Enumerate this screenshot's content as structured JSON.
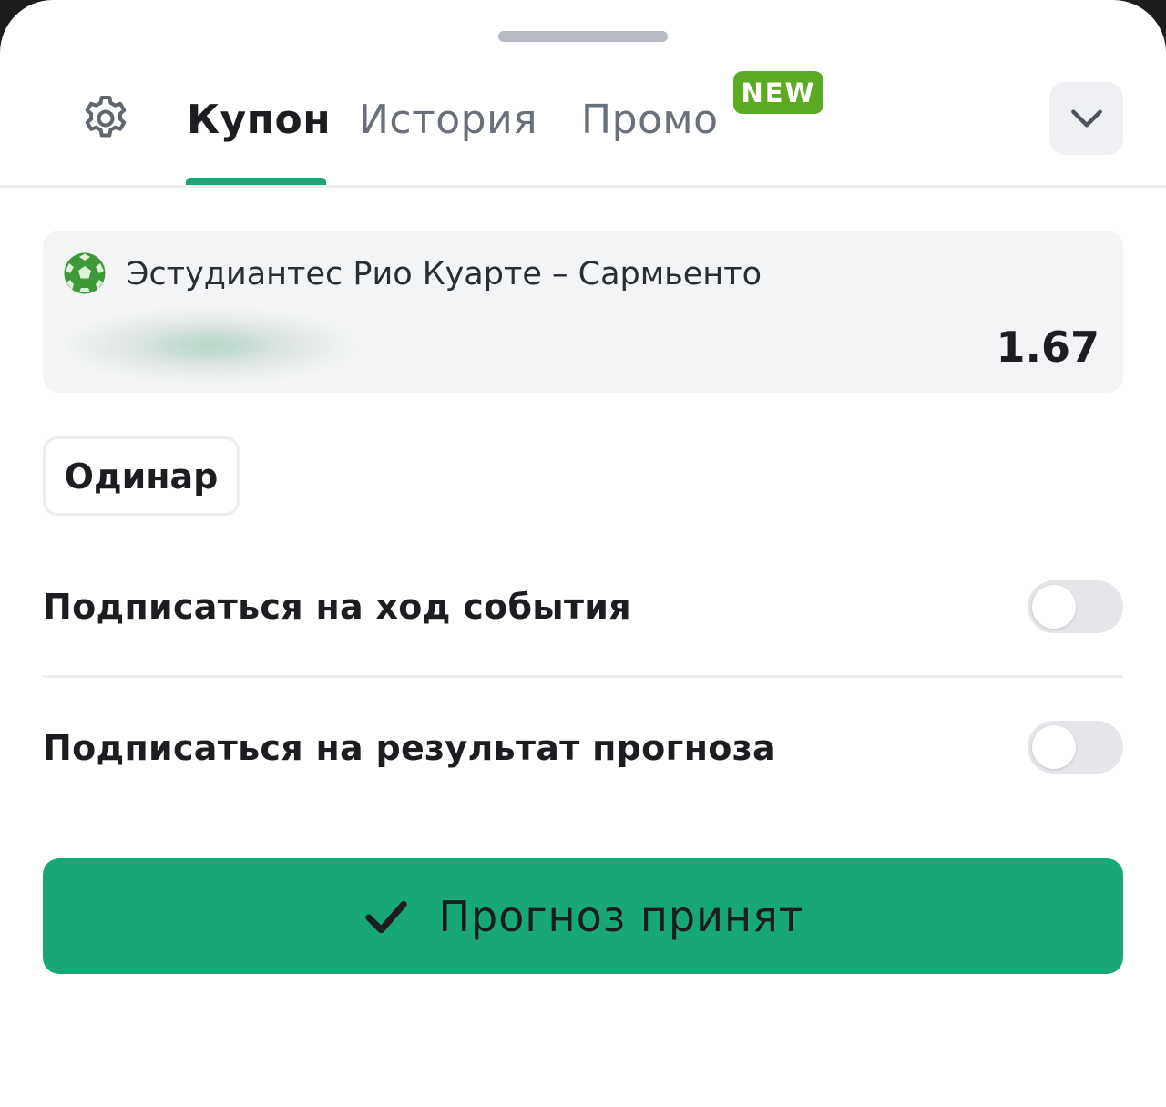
{
  "tabs": [
    {
      "label": "Купон",
      "active": true
    },
    {
      "label": "История",
      "active": false
    },
    {
      "label": "Промо",
      "active": false,
      "badge": "NEW"
    }
  ],
  "event": {
    "sport_icon": "soccer-ball-icon",
    "name": "Эстудиантес Рио Куарте – Сармьенто",
    "odds": "1.67"
  },
  "bet_type": "Одинар",
  "settings": {
    "subscribe_event": {
      "label": "Подписаться на ход события",
      "enabled": false
    },
    "subscribe_result": {
      "label": "Подписаться на результат прогноза",
      "enabled": false
    }
  },
  "submit": {
    "label": "Прогноз принят",
    "icon": "checkmark-icon"
  },
  "colors": {
    "accent": "#18a878",
    "badge": "#5aab22",
    "card": "#f3f4f6"
  }
}
